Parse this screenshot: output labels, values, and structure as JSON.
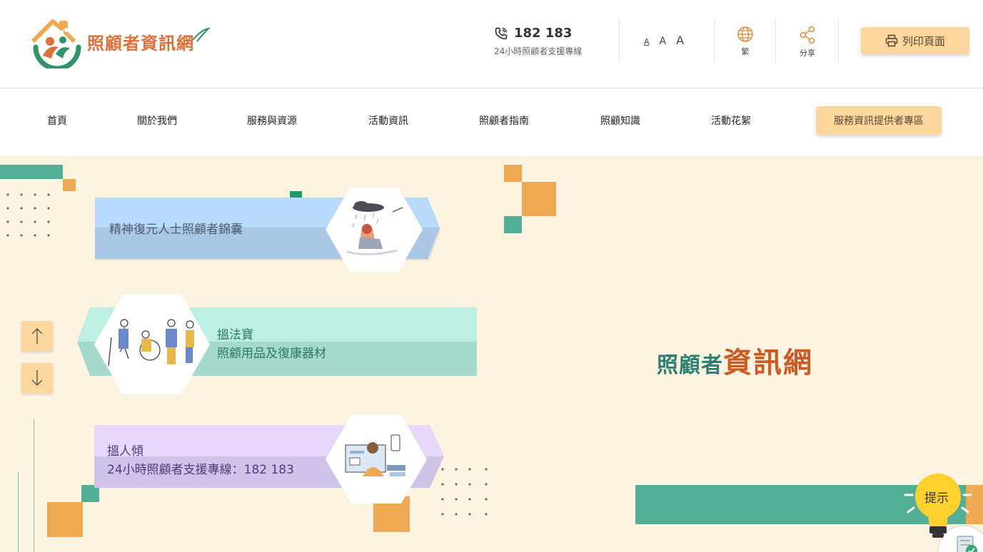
{
  "header": {
    "logo_text": "照顧者資訊網",
    "hotline_number": "182 183",
    "hotline_caption": "24小時照顧者支援專線",
    "font_size_small": "A",
    "font_size_medium": "A",
    "font_size_large": "A",
    "language_label": "繁",
    "share_label": "分享",
    "print_label": "列印頁面"
  },
  "nav": {
    "items": [
      "首頁",
      "關於我們",
      "服務與資源",
      "活動資訊",
      "照顧者指南",
      "照顧知識",
      "活動花絮"
    ],
    "cta_label": "服務資訊提供者專區"
  },
  "cards": [
    {
      "title": "精神復元人士照顧者錦囊",
      "subtitle": ""
    },
    {
      "title": "搵法寶",
      "subtitle": "照顧用品及復康器材"
    },
    {
      "title": "搵人傾",
      "subtitle": "24小時照顧者支援專線：182 183"
    }
  ],
  "site_title": {
    "part1": "照顧者",
    "part2": "資訊網"
  },
  "hint": {
    "label": "提示"
  },
  "colors": {
    "accent_orange": "#f0a953",
    "button_bg": "#fbd79d",
    "teal": "#53ae96",
    "background": "#fcf3e0",
    "title_teal": "#2f7f73",
    "title_orange": "#cc5a22"
  },
  "icons": [
    "phone-icon",
    "globe-icon",
    "share-icon",
    "printer-icon",
    "arrow-up-icon",
    "arrow-down-icon",
    "lightbulb-icon",
    "document-check-icon"
  ]
}
